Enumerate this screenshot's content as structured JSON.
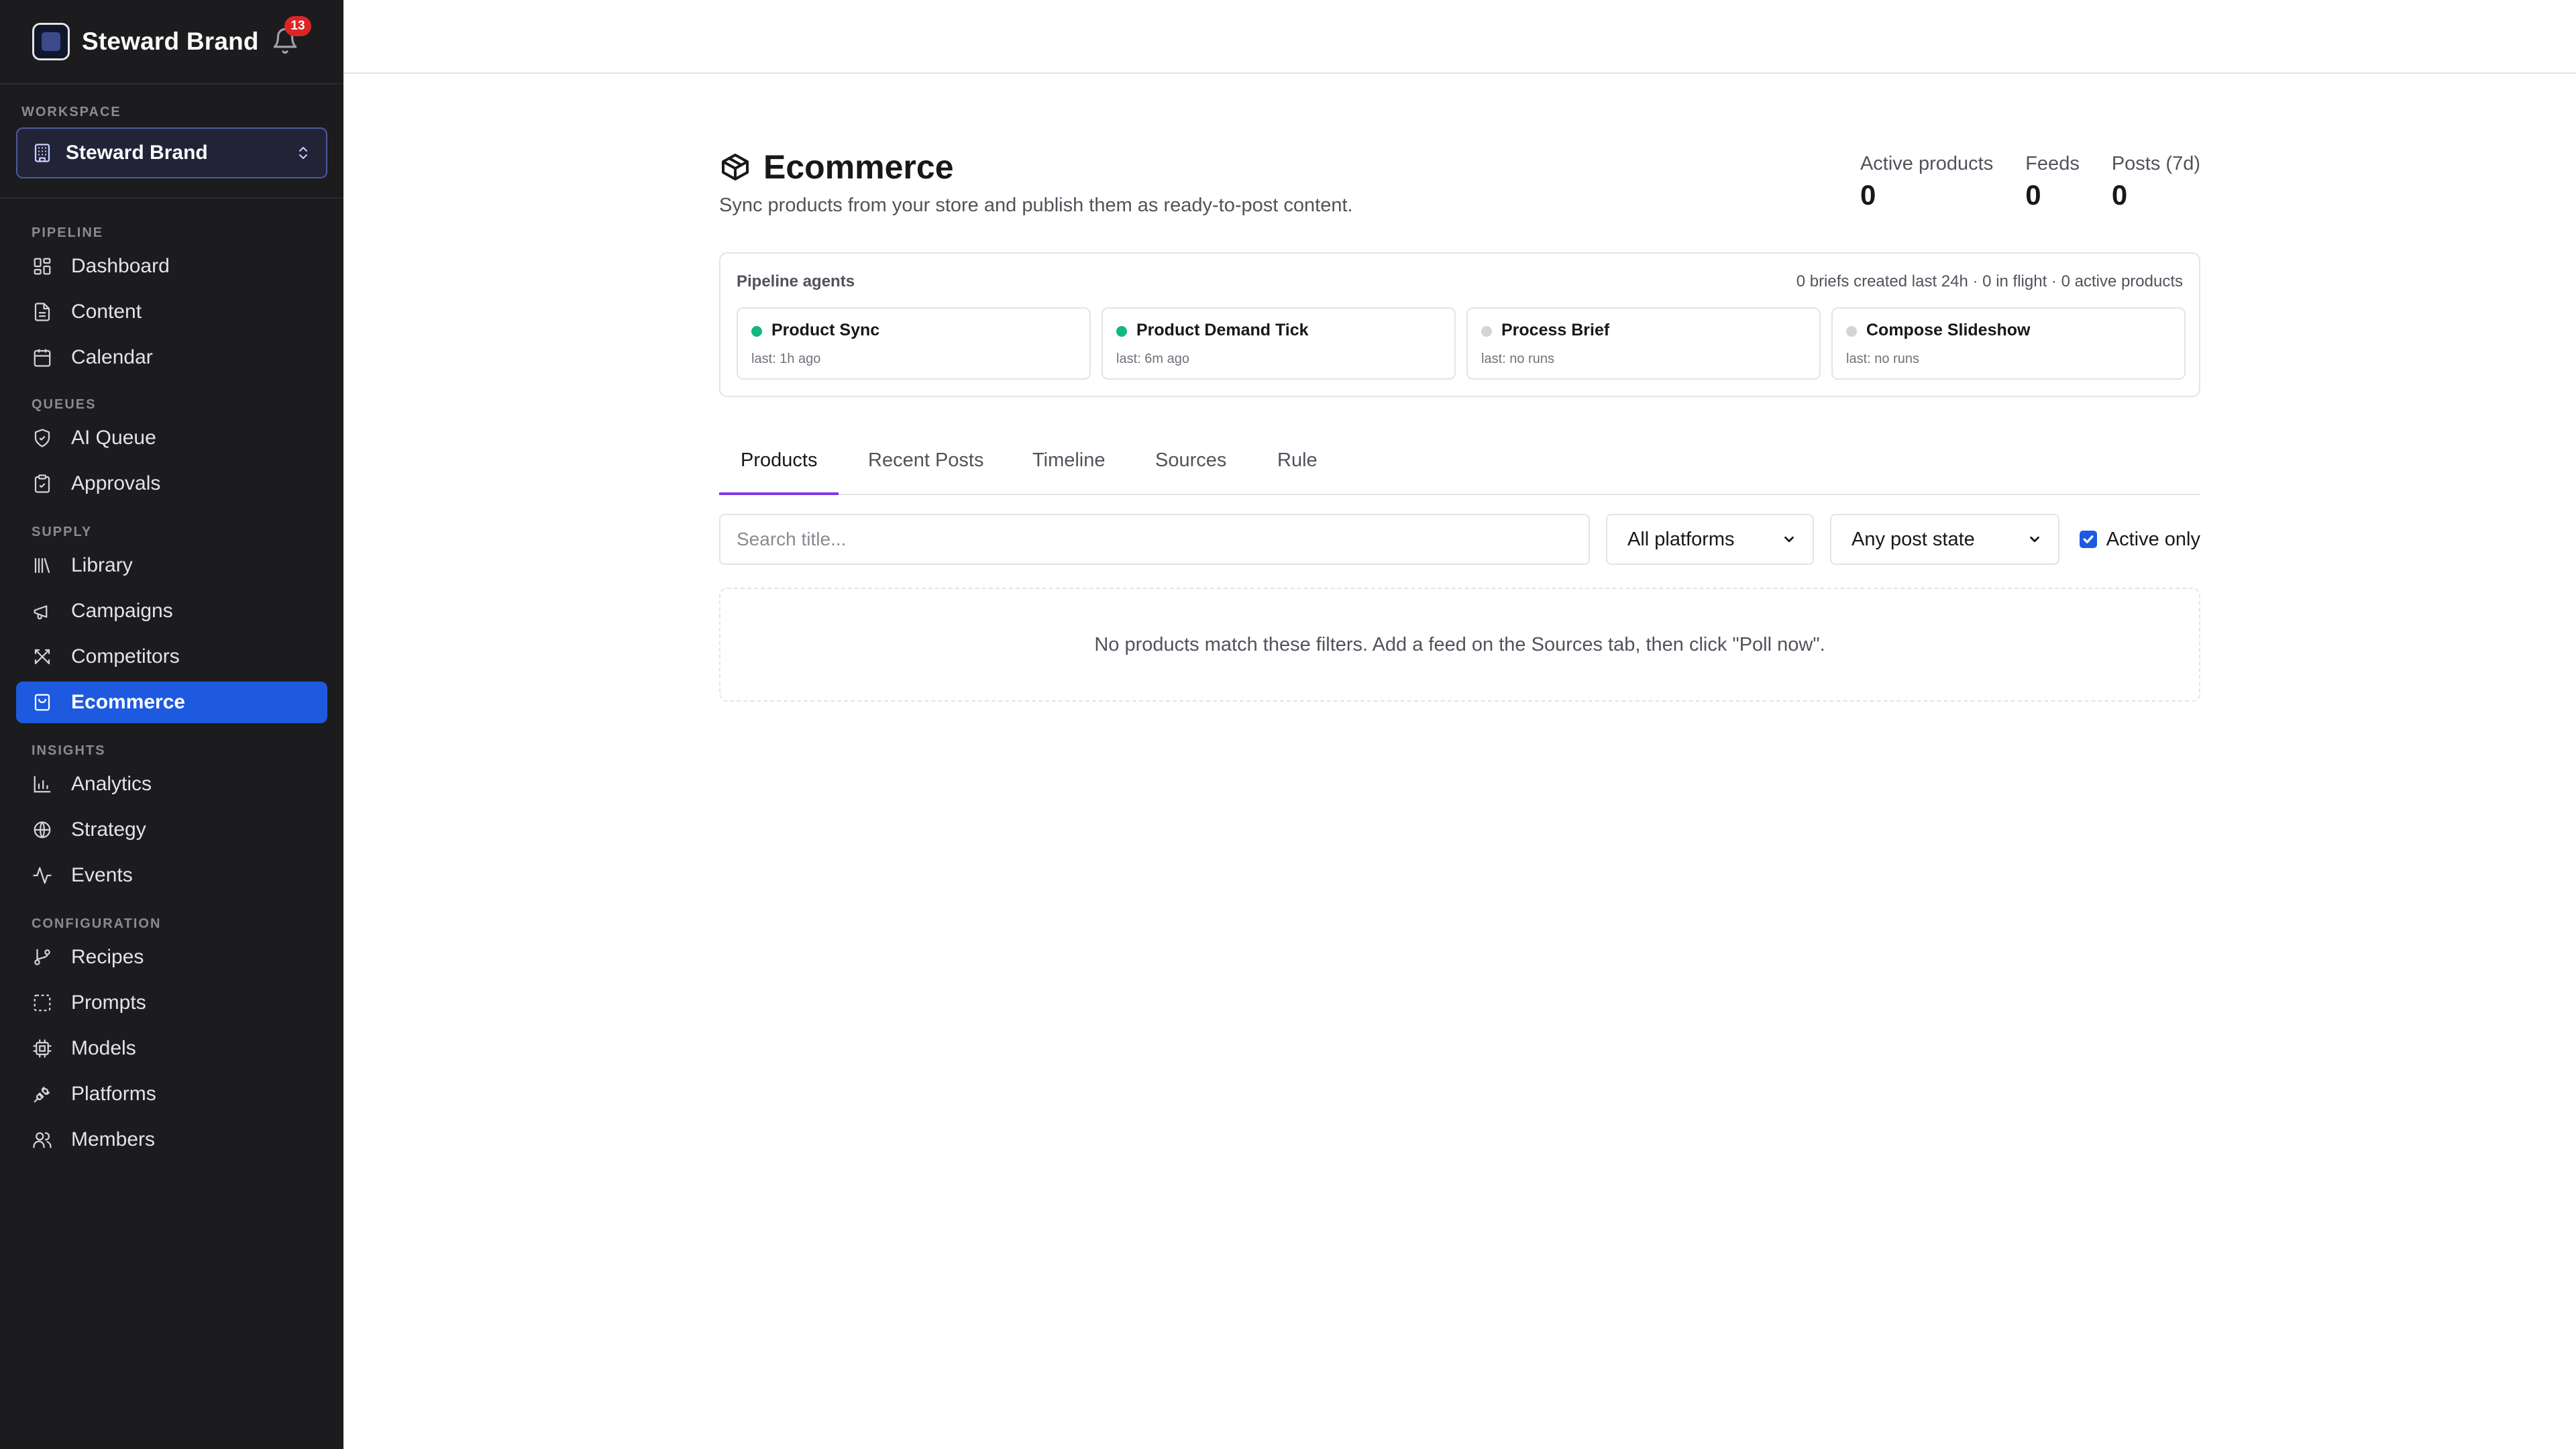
{
  "sidebar": {
    "brand_name": "Steward Brand",
    "notification_count": "13",
    "workspace_label": "Workspace",
    "workspace_name": "Steward Brand",
    "sections": {
      "pipeline": "Pipeline",
      "queues": "Queues",
      "supply": "Supply",
      "insights": "Insights",
      "configuration": "Configuration"
    },
    "items": {
      "dashboard": "Dashboard",
      "content": "Content",
      "calendar": "Calendar",
      "ai_queue": "AI Queue",
      "approvals": "Approvals",
      "library": "Library",
      "campaigns": "Campaigns",
      "competitors": "Competitors",
      "ecommerce": "Ecommerce",
      "analytics": "Analytics",
      "strategy": "Strategy",
      "events": "Events",
      "recipes": "Recipes",
      "prompts": "Prompts",
      "models": "Models",
      "platforms": "Platforms",
      "members": "Members"
    },
    "active_item": "Ecommerce"
  },
  "page": {
    "title": "Ecommerce",
    "subtitle": "Sync products from your store and publish them as ready-to-post content.",
    "stats": [
      {
        "label": "Active products",
        "value": "0"
      },
      {
        "label": "Feeds",
        "value": "0"
      },
      {
        "label": "Posts (7d)",
        "value": "0"
      }
    ]
  },
  "pipeline_agents": {
    "title": "Pipeline agents",
    "summary": "0 briefs created last 24h · 0 in flight · 0 active products",
    "agents": [
      {
        "name": "Product Sync",
        "last": "last: 1h ago",
        "status_color": "#10b981"
      },
      {
        "name": "Product Demand Tick",
        "last": "last: 6m ago",
        "status_color": "#10b981"
      },
      {
        "name": "Process Brief",
        "last": "last: no runs",
        "status_color": "#d4d4d8"
      },
      {
        "name": "Compose Slideshow",
        "last": "last: no runs",
        "status_color": "#d4d4d8"
      }
    ]
  },
  "tabs": [
    "Products",
    "Recent Posts",
    "Timeline",
    "Sources",
    "Rule"
  ],
  "active_tab": "Products",
  "filters": {
    "search_placeholder": "Search title...",
    "platform_select": "All platforms",
    "post_state_select": "Any post state",
    "active_only_label": "Active only",
    "active_only_checked": true
  },
  "empty_state": "No products match these filters. Add a feed on the Sources tab, then click \"Poll now\".",
  "colors": {
    "sidebar_bg": "#1c1c1f",
    "active_nav": "#1d5ae0",
    "tab_underline": "#7c3aed",
    "badge": "#dc2626"
  }
}
